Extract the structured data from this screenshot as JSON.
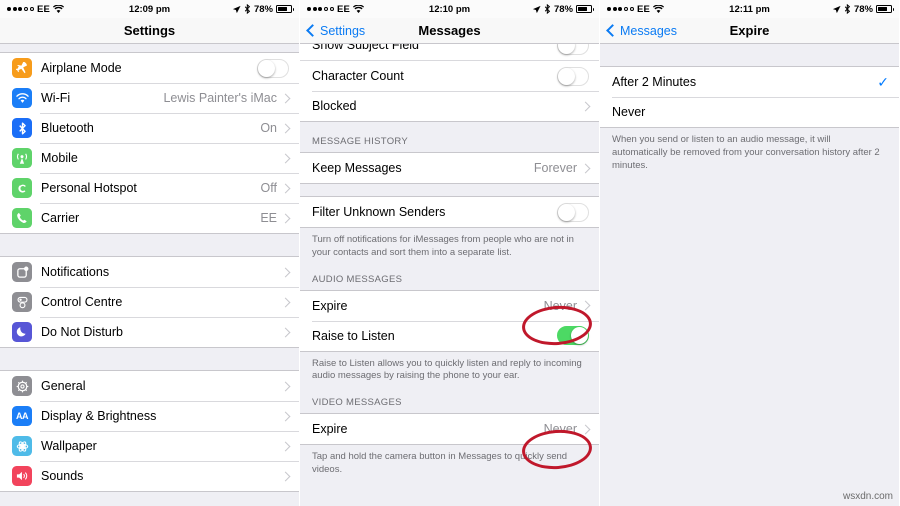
{
  "watermark": "wsxdn.com",
  "panels": [
    {
      "id": "settings",
      "status": {
        "carrier": "EE",
        "time": "12:09 pm",
        "battery_pct": "78%"
      },
      "nav": {
        "title": "Settings",
        "back": ""
      },
      "groups": [
        {
          "rows": [
            {
              "icon": "airplane-icon",
              "label": "Airplane Mode",
              "accessory": "toggle",
              "toggle_on": false
            },
            {
              "icon": "wifi-icon",
              "label": "Wi-Fi",
              "value": "Lewis Painter's iMac",
              "accessory": "chevron"
            },
            {
              "icon": "bluetooth-icon",
              "label": "Bluetooth",
              "value": "On",
              "accessory": "chevron"
            },
            {
              "icon": "cellular-icon",
              "label": "Mobile",
              "value": "",
              "accessory": "chevron"
            },
            {
              "icon": "hotspot-icon",
              "label": "Personal Hotspot",
              "value": "Off",
              "accessory": "chevron"
            },
            {
              "icon": "phone-icon",
              "label": "Carrier",
              "value": "EE",
              "accessory": "chevron"
            }
          ]
        },
        {
          "rows": [
            {
              "icon": "notifications-icon",
              "label": "Notifications",
              "value": "",
              "accessory": "chevron"
            },
            {
              "icon": "control-centre-icon",
              "label": "Control Centre",
              "value": "",
              "accessory": "chevron"
            },
            {
              "icon": "moon-icon",
              "label": "Do Not Disturb",
              "value": "",
              "accessory": "chevron"
            }
          ]
        },
        {
          "rows": [
            {
              "icon": "gear-icon",
              "label": "General",
              "value": "",
              "accessory": "chevron"
            },
            {
              "icon": "display-brightness-icon",
              "label": "Display & Brightness",
              "value": "",
              "accessory": "chevron"
            },
            {
              "icon": "wallpaper-icon",
              "label": "Wallpaper",
              "value": "",
              "accessory": "chevron"
            },
            {
              "icon": "sounds-icon",
              "label": "Sounds",
              "value": "",
              "accessory": "chevron"
            }
          ]
        }
      ]
    },
    {
      "id": "messages",
      "status": {
        "carrier": "EE",
        "time": "12:10 pm",
        "battery_pct": "78%"
      },
      "nav": {
        "title": "Messages",
        "back": "Settings"
      },
      "clipped_row": {
        "label": "Show Subject Field",
        "accessory": "toggle",
        "toggle_on": false
      },
      "rows_top": [
        {
          "label": "Character Count",
          "accessory": "toggle",
          "toggle_on": false
        },
        {
          "label": "Blocked",
          "value": "",
          "accessory": "chevron"
        }
      ],
      "section_history": "MESSAGE HISTORY",
      "rows_history": [
        {
          "label": "Keep Messages",
          "value": "Forever",
          "accessory": "chevron"
        }
      ],
      "rows_filter": [
        {
          "label": "Filter Unknown Senders",
          "accessory": "toggle",
          "toggle_on": false
        }
      ],
      "note_filter": "Turn off notifications for iMessages from people who are not in your contacts and sort them into a separate list.",
      "section_audio": "AUDIO MESSAGES",
      "rows_audio": [
        {
          "label": "Expire",
          "value": "Never",
          "accessory": "chevron",
          "annotated": true
        },
        {
          "label": "Raise to Listen",
          "accessory": "toggle",
          "toggle_on": true
        }
      ],
      "note_audio": "Raise to Listen allows you to quickly listen and reply to incoming audio messages by raising the phone to your ear.",
      "section_video": "VIDEO MESSAGES",
      "rows_video": [
        {
          "label": "Expire",
          "value": "Never",
          "accessory": "chevron",
          "annotated": true
        }
      ],
      "note_video": "Tap and hold the camera button in Messages to quickly send videos."
    },
    {
      "id": "expire",
      "status": {
        "carrier": "EE",
        "time": "12:11 pm",
        "battery_pct": "78%"
      },
      "nav": {
        "title": "Expire",
        "back": "Messages"
      },
      "options": [
        {
          "label": "After 2 Minutes",
          "selected": true
        },
        {
          "label": "Never",
          "selected": false
        }
      ],
      "note": "When you send or listen to an audio message, it will automatically be removed from your conversation history after 2 minutes."
    }
  ],
  "colors": {
    "accent_blue": "#0b7bf3",
    "toggle_green": "#4cd964",
    "annotation_red": "#c0182b",
    "group_bg": "#efeff4"
  }
}
